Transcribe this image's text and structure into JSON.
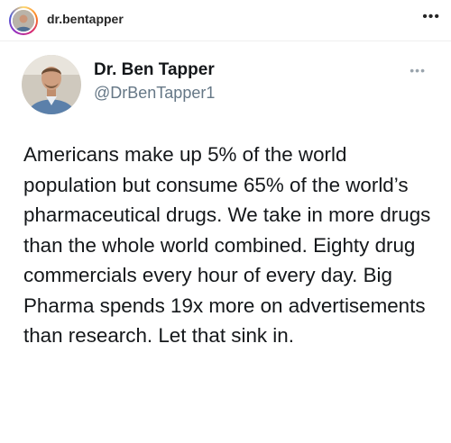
{
  "header": {
    "username": "dr.bentapper",
    "more_icon": "more-horizontal-icon"
  },
  "tweet": {
    "display_name": "Dr. Ben Tapper",
    "handle": "@DrBenTapper1",
    "more_icon": "more-horizontal-icon",
    "text": "Americans make up 5% of the world population but consume 65% of the world’s pharmaceutical drugs. We take in more drugs than the whole world combined. Eighty drug commercials every hour of every day. Big Pharma spends 19x more on advertisements than research. Let that sink in."
  },
  "colors": {
    "background": "#ffffff",
    "name": "#14171a",
    "handle": "#657786",
    "divider": "#efefef"
  }
}
